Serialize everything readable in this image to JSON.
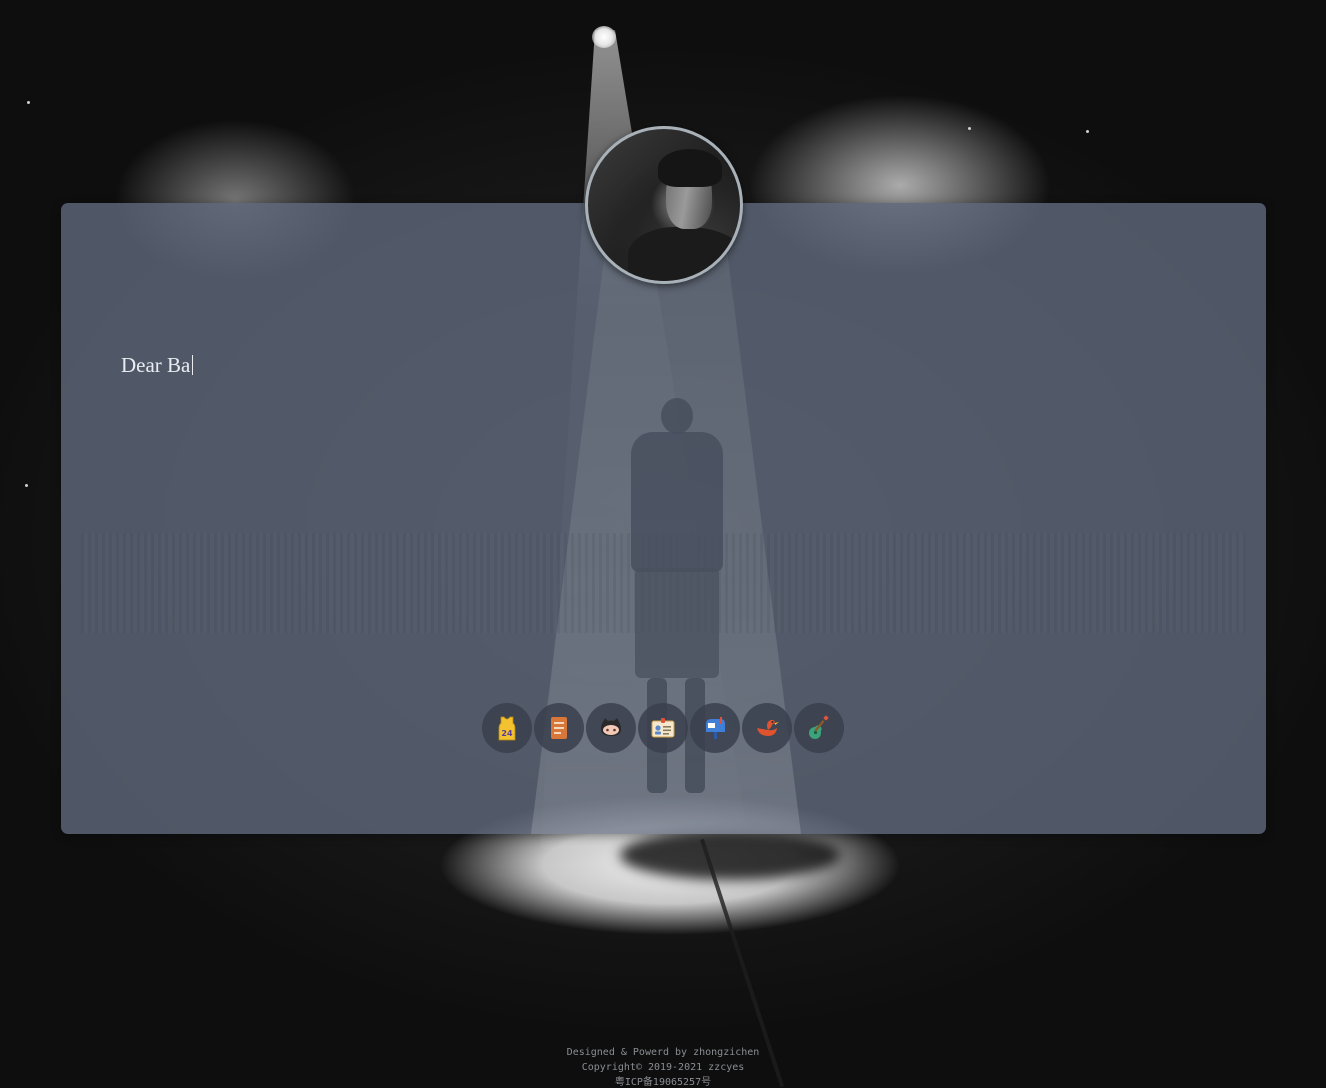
{
  "main": {
    "typed_text": "Dear Ba"
  },
  "avatar": {
    "icon": "user-portrait"
  },
  "links": [
    {
      "icon": "jersey-24-icon"
    },
    {
      "icon": "document-icon"
    },
    {
      "icon": "github-octocat-icon"
    },
    {
      "icon": "id-card-icon"
    },
    {
      "icon": "mailbox-icon"
    },
    {
      "icon": "bird-icon"
    },
    {
      "icon": "guitar-icon"
    }
  ],
  "footer": {
    "designed_by": "Designed & Powerd by zhongzichen",
    "copyright": "Copyright© 2019-2021 zzcyes",
    "icp": "粤ICP备19065257号"
  },
  "colors": {
    "panel": "#5e687a",
    "background": "#141414",
    "footer_text": "#8a8e93",
    "jersey_yellow": "#f2c230",
    "doc_orange": "#d9773a",
    "mail_blue": "#3f7fd8",
    "bird_red": "#e0532e",
    "guitar_green": "#3ca37a"
  }
}
